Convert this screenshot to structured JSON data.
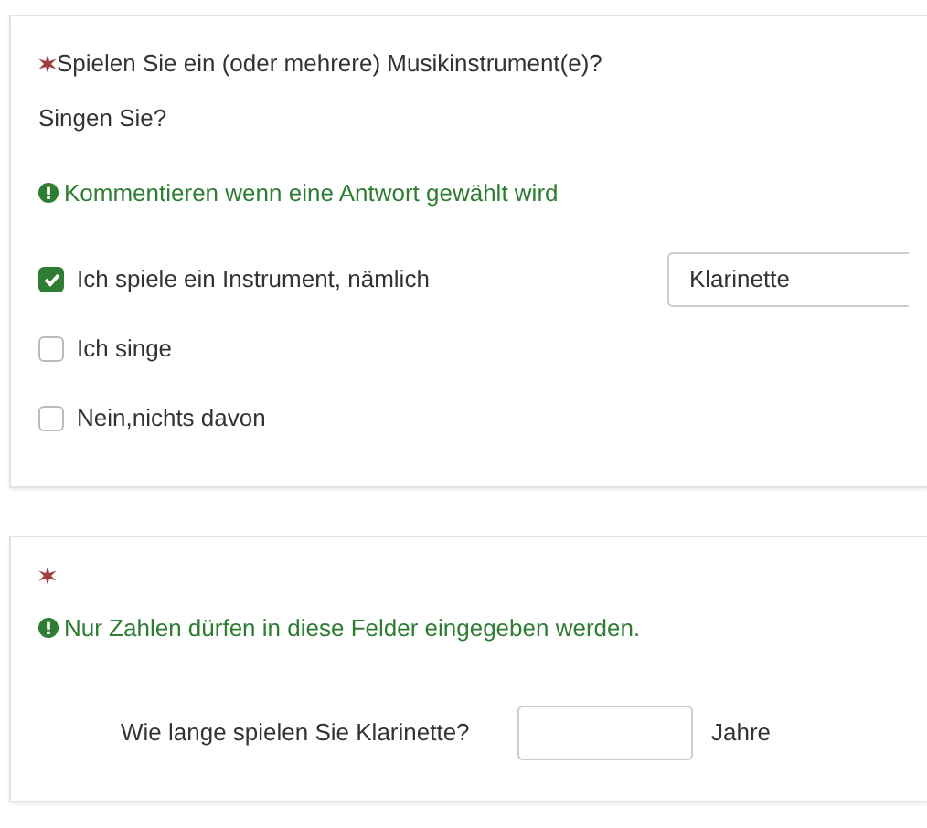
{
  "questions": [
    {
      "required": true,
      "text": "Spielen Sie ein (oder mehrere) Musikinstrument(e)?",
      "subtext": "Singen Sie?",
      "tip": "Kommentieren wenn eine Antwort gewählt wird",
      "kind": "checkboxes",
      "options": [
        {
          "label": "Ich spiele ein Instrument, nämlich",
          "checked": true,
          "comment": "Klarinette"
        },
        {
          "label": "Ich singe",
          "checked": false
        },
        {
          "label": "Nein,nichts davon",
          "checked": false
        }
      ]
    },
    {
      "required": true,
      "tip": "Nur Zahlen dürfen in diese Felder eingegeben werden.",
      "kind": "numeric",
      "rows": [
        {
          "label": "Wie lange spielen Sie Klarinette?",
          "unit": "Jahre"
        }
      ]
    }
  ]
}
